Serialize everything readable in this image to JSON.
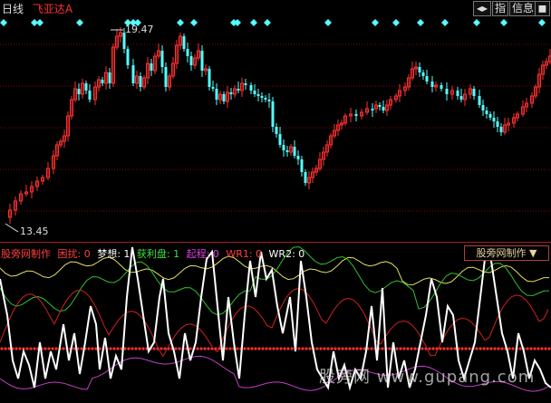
{
  "header": {
    "period": "日线",
    "indicator_name": "飞亚达A",
    "buttons": [
      {
        "label": "◂▸",
        "name": "toggle-icon"
      },
      {
        "label": "指",
        "name": "index-button"
      },
      {
        "label": "信息",
        "name": "info-button"
      },
      {
        "label": "◼",
        "name": "window-icon"
      }
    ]
  },
  "price_labels": {
    "high": "19.47",
    "low": "13.45"
  },
  "sub_header": {
    "site": "股旁网制作",
    "items": [
      {
        "label": "困扰: 0",
        "color": "#ff4040"
      },
      {
        "label": "梦想: 1",
        "color": "#ffffff"
      },
      {
        "label": "获利盘: 1",
        "color": "#40e040"
      },
      {
        "label": "起程: 0",
        "color": "#e040e0"
      },
      {
        "label": "WR1: 0",
        "color": "#ff4040"
      },
      {
        "label": "WR2: 0",
        "color": "#ffffff"
      }
    ],
    "formula_button": "股旁网制作 ▼"
  },
  "watermark": "股旁网 www.gupang.com",
  "colors": {
    "up": "#ff3030",
    "down": "#54ffff",
    "grid": "#8b0000",
    "signal": "#54ffff",
    "yellow": "#e0e060",
    "green": "#30c030",
    "magenta": "#c040c0",
    "red_dotted": "#ff3030",
    "white": "#ffffff"
  },
  "chart_data": {
    "type": "line",
    "price_range": [
      13.45,
      19.47
    ],
    "signal_markers": [
      37,
      52,
      66,
      88,
      106,
      118,
      144,
      161
    ]
  }
}
